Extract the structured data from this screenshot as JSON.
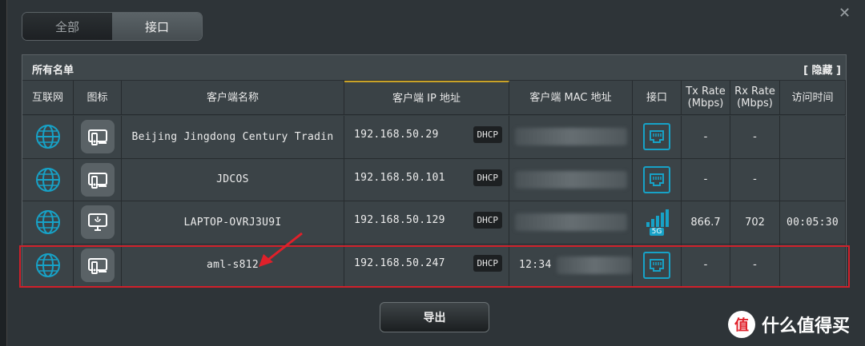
{
  "tabs": [
    "全部",
    "接口"
  ],
  "header": {
    "title": "所有名单",
    "hide_label": "[ 隐藏 ]"
  },
  "columns": [
    "互联网",
    "图标",
    "客户端名称",
    "客户端 IP 地址",
    "客户端 MAC 地址",
    "接口",
    "Tx Rate\n(Mbps)",
    "Rx Rate\n(Mbps)",
    "访问时间"
  ],
  "rows": [
    {
      "name": "Beijing Jingdong Century Tradin",
      "ip": "192.168.50.29",
      "ip_type": "DHCP",
      "mac": "",
      "interface": "ethernet",
      "tx": "-",
      "rx": "-",
      "access_time": "",
      "device_icon": "device-icon"
    },
    {
      "name": "JDCOS",
      "ip": "192.168.50.101",
      "ip_type": "DHCP",
      "mac": "",
      "interface": "ethernet",
      "tx": "-",
      "rx": "-",
      "access_time": "",
      "device_icon": "device-icon"
    },
    {
      "name": "LAPTOP-OVRJ3U9I",
      "ip": "192.168.50.129",
      "ip_type": "DHCP",
      "mac": "",
      "interface": "wifi-5g",
      "wifi_band": "5G",
      "tx": "866.7",
      "rx": "702",
      "access_time": "00:05:30",
      "device_icon": "monitor-icon"
    },
    {
      "name": "aml-s812",
      "ip": "192.168.50.247",
      "ip_type": "DHCP",
      "mac": "12:34",
      "interface": "ethernet",
      "tx": "-",
      "rx": "-",
      "access_time": "",
      "device_icon": "device-icon"
    }
  ],
  "export_label": "导出",
  "watermark": {
    "text": "什么值得买",
    "logo": "值"
  },
  "colors": {
    "accent_cyan": "#17a2c7",
    "highlight_red": "#d0202a",
    "sorted_underline": "#c9a227"
  }
}
